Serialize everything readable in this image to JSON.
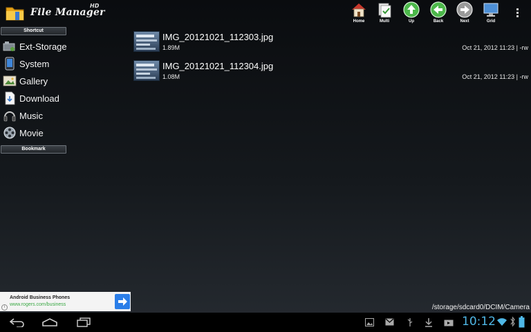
{
  "app": {
    "logo_text": "File Manager",
    "logo_badge": "HD"
  },
  "toolbar": {
    "items": [
      {
        "label": "Home",
        "icon": "home-icon"
      },
      {
        "label": "Multi",
        "icon": "multi-select-icon"
      },
      {
        "label": "Up",
        "icon": "arrow-up-icon"
      },
      {
        "label": "Back",
        "icon": "arrow-back-icon"
      },
      {
        "label": "Next",
        "icon": "arrow-next-icon"
      },
      {
        "label": "Grid",
        "icon": "grid-monitor-icon"
      }
    ],
    "overflow_icon": "overflow-menu-icon"
  },
  "sidebar": {
    "shortcut_header": "Shortcut",
    "bookmark_header": "Bookmark",
    "items": [
      {
        "label": "Ext-Storage",
        "icon": "ext-storage-icon"
      },
      {
        "label": "System",
        "icon": "system-phone-icon"
      },
      {
        "label": "Gallery",
        "icon": "gallery-icon"
      },
      {
        "label": "Download",
        "icon": "download-icon"
      },
      {
        "label": "Music",
        "icon": "music-headphones-icon"
      },
      {
        "label": "Movie",
        "icon": "movie-reel-icon"
      }
    ]
  },
  "files": [
    {
      "name": "IMG_20121021_112303.jpg",
      "size": "1.89M",
      "meta": "Oct 21, 2012 11:23 | -rw"
    },
    {
      "name": "IMG_20121021_112304.jpg",
      "size": "1.08M",
      "meta": "Oct 21, 2012 11:23 | -rw"
    }
  ],
  "ad": {
    "title": "Android Business Phones",
    "url": "www.rogers.com/business",
    "info": "i"
  },
  "current_path": "/storage/sdcard0/DCIM/Camera",
  "system_bar": {
    "clock": "10:12",
    "accent": "#4fb7e6"
  }
}
